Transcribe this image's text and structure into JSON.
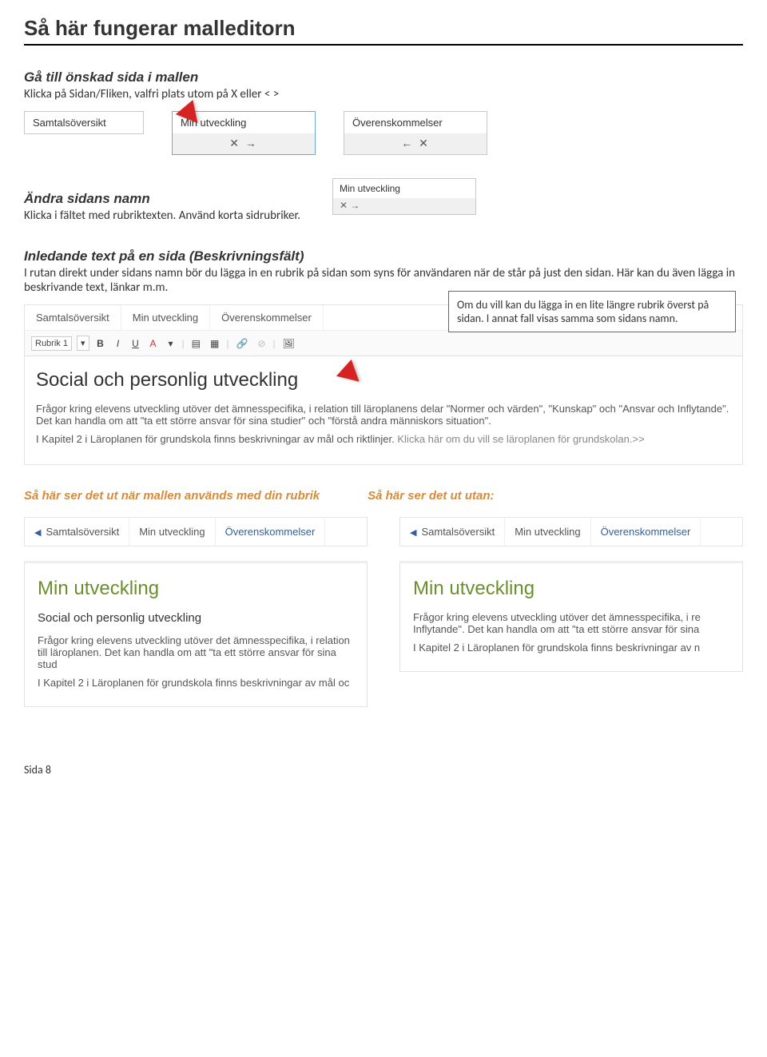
{
  "title": "Så här fungerar malleditorn",
  "section1": {
    "heading": "Gå till önskad sida i mallen",
    "text": "Klicka på Sidan/Fliken, valfri plats utom på X eller < >"
  },
  "tabs_screenshot1": {
    "plain": "Samtalsöversikt",
    "active_label": "Min utveckling",
    "active_icons": "✕ →",
    "third_label": "Överenskommelser",
    "third_icons": "← ✕"
  },
  "section2": {
    "heading": "Ändra sidans namn",
    "text": "Klicka i fältet med rubriktexten. Använd korta sidrubriker."
  },
  "mini_card": {
    "label": "Min utveckling",
    "icons": "✕ →"
  },
  "section3": {
    "heading": "Inledande text på en sida (Beskrivningsfält)",
    "text": "I rutan direkt under sidans namn bör du lägga in en rubrik på sidan som syns för användaren när de står på just den sidan. Här kan du även lägga in beskrivande text, länkar m.m."
  },
  "editor": {
    "tabs": [
      "Samtalsöversikt",
      "Min utveckling",
      "Överenskommelser"
    ],
    "toolbar_select": "Rubrik 1",
    "body_heading": "Social och personlig utveckling",
    "body_p1": "Frågor kring elevens utveckling utöver det ämnesspecifika, i relation till läroplanens delar \"Normer och värden\", \"Kunskap\" och \"Ansvar och Inflytande\". Det kan handla om att \"ta ett större ansvar för sina studier\" och \"förstå andra människors situation\".",
    "body_p2": "I Kapitel 2 i Läroplanen för grundskola finns beskrivningar av mål och riktlinjer.",
    "body_link": "Klicka här om du vill se läroplanen för grundskolan.>>"
  },
  "callout": "Om du vill kan du lägga in en lite längre rubrik överst på sidan.  I annat fall visas samma som sidans namn.",
  "compare_headings": {
    "with_rubrik": "Så här ser det ut när mallen används med din rubrik",
    "without": "Så här ser det ut utan:"
  },
  "preview_left": {
    "tabs": [
      "Samtalsöversikt",
      "Min utveckling",
      "Överenskommelser"
    ],
    "h2": "Min utveckling",
    "h4": "Social och personlig utveckling",
    "p1": "Frågor kring elevens utveckling utöver det ämnesspecifika, i relation till läroplanen. Det kan handla om att \"ta ett större ansvar för sina stud",
    "p2": "I Kapitel 2 i Läroplanen för grundskola finns beskrivningar av mål oc"
  },
  "preview_right": {
    "tabs": [
      "Samtalsöversikt",
      "Min utveckling",
      "Överenskommelser"
    ],
    "h2": "Min utveckling",
    "p1": "Frågor kring elevens utveckling utöver det ämnesspecifika, i re Inflytande\". Det kan handla om att \"ta ett större ansvar för sina",
    "p2": "I Kapitel 2 i Läroplanen för grundskola finns beskrivningar av n"
  },
  "footer": "Sida 8"
}
